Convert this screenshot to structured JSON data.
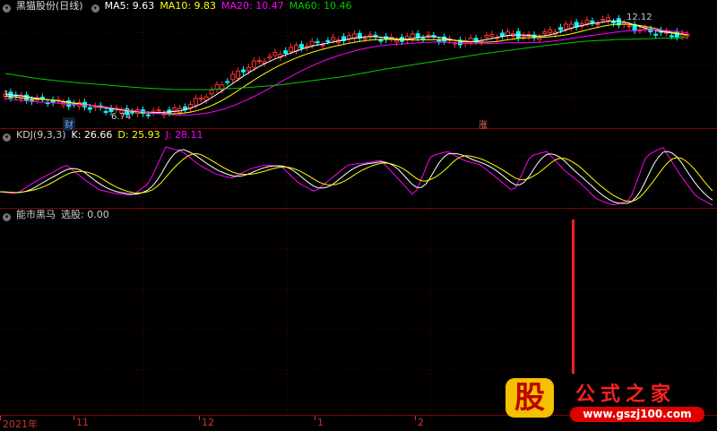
{
  "main": {
    "title": "黑猫股份(日线)",
    "ma5": "MA5: 9.63",
    "ma10": "MA10: 9.83",
    "ma20": "MA20: 10.47",
    "ma60": "MA60: 10.46",
    "high_label": "12.12",
    "low_label": "6.74",
    "left_price": "1",
    "badge_cai": "财",
    "badge_zhang": "涨",
    "colors": {
      "ma5": "#ffffff",
      "ma10": "#ffff00",
      "ma20": "#ff00ff",
      "ma60": "#00cc00",
      "up": "#ff3030",
      "down": "#00ffff"
    }
  },
  "kdj": {
    "name": "KDJ(9,3,3)",
    "k": "K: 26.66",
    "d": "D: 25.93",
    "j": "J: 28.11"
  },
  "ind": {
    "name": "能市黑马",
    "pick": "选股: 0.00"
  },
  "axis": {
    "labels": [
      "2021年",
      "11",
      "12",
      "1",
      "2"
    ]
  },
  "logo": {
    "gu": "股",
    "cn": "公式之家",
    "url": "www.gszj100.com"
  }
}
